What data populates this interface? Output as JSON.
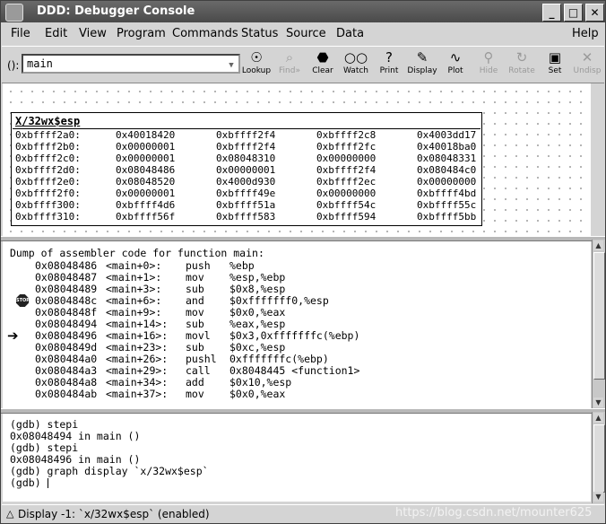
{
  "window": {
    "title": "DDD: Debugger Console"
  },
  "menu": [
    {
      "label": "File"
    },
    {
      "label": "Edit"
    },
    {
      "label": "View"
    },
    {
      "label": "Program"
    },
    {
      "label": "Commands"
    },
    {
      "label": "Status"
    },
    {
      "label": "Source"
    },
    {
      "label": "Data"
    },
    {
      "label": "Help"
    }
  ],
  "toolbar": {
    "arg_prefix": "():",
    "arg_value": "main",
    "tools": [
      {
        "label": "Lookup",
        "icon": "lookup-icon",
        "enabled": true
      },
      {
        "label": "Find»",
        "icon": "find-icon",
        "enabled": false
      },
      {
        "label": "Clear",
        "icon": "clear-icon",
        "enabled": true
      },
      {
        "label": "Watch",
        "icon": "watch-icon",
        "enabled": true
      },
      {
        "label": "Print",
        "icon": "print-icon",
        "enabled": true
      },
      {
        "label": "Display",
        "icon": "display-icon",
        "enabled": true
      },
      {
        "label": "Plot",
        "icon": "plot-icon",
        "enabled": true
      },
      {
        "label": "Hide",
        "icon": "hide-icon",
        "enabled": false
      },
      {
        "label": "Rotate",
        "icon": "rotate-icon",
        "enabled": false
      },
      {
        "label": "Set",
        "icon": "set-icon",
        "enabled": true
      },
      {
        "label": "Undisp",
        "icon": "undisp-icon",
        "enabled": false
      }
    ]
  },
  "data_display": {
    "title": "X/32wx$esp",
    "rows": [
      [
        "0xbffff2a0:",
        "0x40018420",
        "0xbffff2f4",
        "0xbffff2c8",
        "0x4003dd17"
      ],
      [
        "0xbffff2b0:",
        "0x00000001",
        "0xbffff2f4",
        "0xbffff2fc",
        "0x40018ba0"
      ],
      [
        "0xbffff2c0:",
        "0x00000001",
        "0x08048310",
        "0x00000000",
        "0x08048331"
      ],
      [
        "0xbffff2d0:",
        "0x08048486",
        "0x00000001",
        "0xbffff2f4",
        "0x080484c0"
      ],
      [
        "0xbffff2e0:",
        "0x08048520",
        "0x4000d930",
        "0xbffff2ec",
        "0x00000000"
      ],
      [
        "0xbffff2f0:",
        "0x00000001",
        "0xbffff49e",
        "0x00000000",
        "0xbffff4bd"
      ],
      [
        "0xbffff300:",
        "0xbffff4d6",
        "0xbffff51a",
        "0xbffff54c",
        "0xbffff55c"
      ],
      [
        "0xbffff310:",
        "0xbffff56f",
        "0xbffff583",
        "0xbffff594",
        "0xbffff5bb"
      ]
    ]
  },
  "assembler": {
    "header": "Dump of assembler code for function main:",
    "rows": [
      {
        "addr": "0x08048486",
        "sym": "<main+0>:",
        "op": "push",
        "args": "%ebp"
      },
      {
        "addr": "0x08048487",
        "sym": "<main+1>:",
        "op": "mov",
        "args": "%esp,%ebp"
      },
      {
        "addr": "0x08048489",
        "sym": "<main+3>:",
        "op": "sub",
        "args": "$0x8,%esp"
      },
      {
        "addr": "0x0804848c",
        "sym": "<main+6>:",
        "op": "and",
        "args": "$0xfffffff0,%esp",
        "breakpoint": true,
        "stop_label": "STOP"
      },
      {
        "addr": "0x0804848f",
        "sym": "<main+9>:",
        "op": "mov",
        "args": "$0x0,%eax"
      },
      {
        "addr": "0x08048494",
        "sym": "<main+14>:",
        "op": "sub",
        "args": "%eax,%esp"
      },
      {
        "addr": "0x08048496",
        "sym": "<main+16>:",
        "op": "movl",
        "args": "$0x3,0xfffffffc(%ebp)",
        "current": true
      },
      {
        "addr": "0x0804849d",
        "sym": "<main+23>:",
        "op": "sub",
        "args": "$0xc,%esp"
      },
      {
        "addr": "0x080484a0",
        "sym": "<main+26>:",
        "op": "pushl",
        "args": "0xfffffffc(%ebp)"
      },
      {
        "addr": "0x080484a3",
        "sym": "<main+29>:",
        "op": "call",
        "args": "0x8048445 <function1>"
      },
      {
        "addr": "0x080484a8",
        "sym": "<main+34>:",
        "op": "add",
        "args": "$0x10,%esp"
      },
      {
        "addr": "0x080484ab",
        "sym": "<main+37>:",
        "op": "mov",
        "args": "$0x0,%eax"
      }
    ]
  },
  "console": {
    "lines": [
      "(gdb) stepi",
      "0x08048494 in main ()",
      "(gdb) stepi",
      "0x08048496 in main ()",
      "(gdb) graph display `x/32wx$esp`",
      "(gdb) "
    ]
  },
  "status": {
    "text": "Display -1: `x/32wx$esp` (enabled)"
  },
  "watermark": "https://blog.csdn.net/mounter625"
}
